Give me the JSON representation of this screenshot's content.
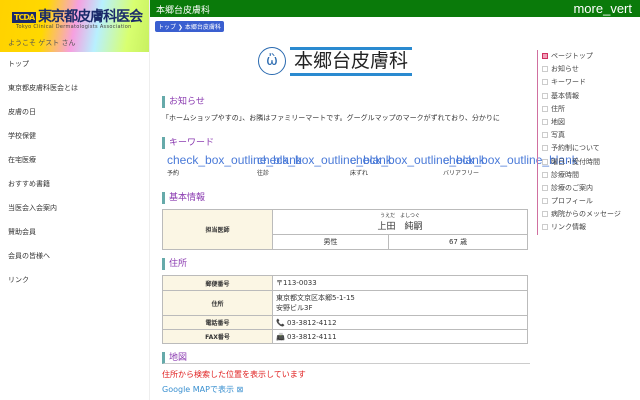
{
  "sidebar": {
    "logo_text": "東京都皮膚科医会",
    "logo_mark": "TCDA",
    "logo_sub": "Tokyo Clinical Dermatologists Association",
    "welcome": "ようこそ ゲスト さん",
    "items": [
      "トップ",
      "東京都皮膚科医会とは",
      "皮膚の日",
      "学校保健",
      "在宅医療",
      "おすすめ書籍",
      "当医会入会案内",
      "賛助会員",
      "会員の皆様へ",
      "リンク"
    ]
  },
  "header": {
    "title": "本郷台皮膚科",
    "more": "more_vert"
  },
  "breadcrumb": [
    "トップ",
    "本郷台皮膚科"
  ],
  "clinic": {
    "name": "本郷台皮膚科"
  },
  "notice": {
    "heading": "お知らせ",
    "text": "「ホームショップやすの」、お隣はファミリーマートです。グーグルマップのマークがずれており、分かりに"
  },
  "keywords": {
    "heading": "キーワード",
    "icon_text": "check_box_outline_blank",
    "items": [
      "予約",
      "往診",
      "床ずれ",
      "バリアフリー"
    ]
  },
  "basic": {
    "heading": "基本情報",
    "doctor_label": "担当医師",
    "furigana": "うえだ　よしつぐ",
    "name": "上田　純嗣",
    "gender": "男性",
    "age": "67 歳"
  },
  "address": {
    "heading": "住所",
    "rows": [
      {
        "label": "郵便番号",
        "value": "〒113-0033"
      },
      {
        "label": "住所",
        "value": "東京都文京区本郷5-1-15",
        "value2": "安野ビル3F"
      },
      {
        "label": "電話番号",
        "value": "📞 03-3812-4112"
      },
      {
        "label": "FAX番号",
        "value": "📠 03-3812-4111"
      }
    ]
  },
  "map": {
    "heading": "地図",
    "note": "住所から検索した位置を表示しています",
    "link": "Google MAPで表示"
  },
  "toc": [
    "ページトップ",
    "お知らせ",
    "キーワード",
    "基本情報",
    "住所",
    "地図",
    "写真",
    "予約制について",
    "曜日・受付時間",
    "診療時間",
    "診療のご案内",
    "プロフィール",
    "病院からのメッセージ",
    "リンク情報"
  ]
}
